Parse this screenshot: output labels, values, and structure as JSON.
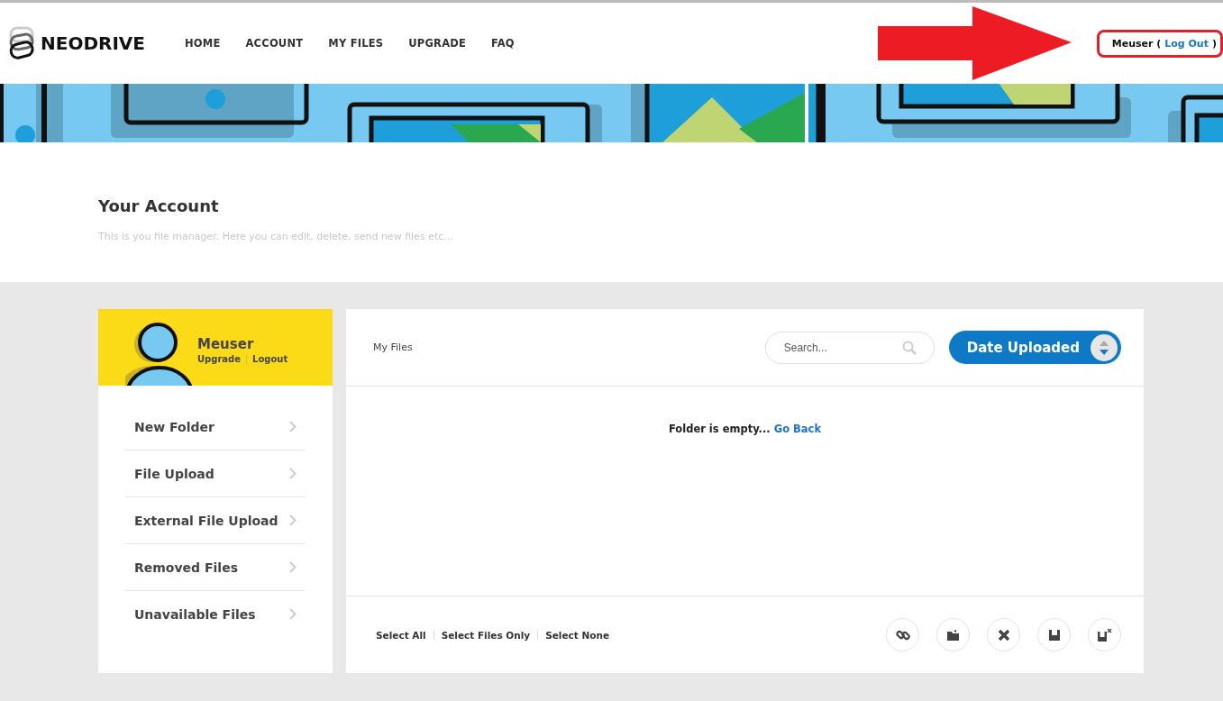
{
  "header": {
    "brand": "NEODRIVE",
    "nav": [
      {
        "label": "HOME"
      },
      {
        "label": "ACCOUNT"
      },
      {
        "label": "MY FILES"
      },
      {
        "label": "UPGRADE"
      },
      {
        "label": "FAQ"
      }
    ],
    "user": {
      "name": "Meuser",
      "open": "(",
      "link": "Log Out",
      "close": ")"
    }
  },
  "intro": {
    "title": "Your Account",
    "subtitle": "This is you file manager. Here you can edit, delete, send new files etc..."
  },
  "profile": {
    "name": "Meuser",
    "links": [
      "Upgrade",
      "Logout"
    ]
  },
  "menu": [
    {
      "label": "New Folder"
    },
    {
      "label": "File Upload"
    },
    {
      "label": "External File Upload"
    },
    {
      "label": "Removed Files"
    },
    {
      "label": "Unavailable Files"
    }
  ],
  "files": {
    "breadcrumb": "My Files",
    "search": {
      "placeholder": "Search..."
    },
    "sort": "Date Uploaded",
    "empty": "Folder is empty...",
    "back": "Go Back",
    "select": [
      "Select All",
      "Select Files Only",
      "Select None"
    ],
    "actions": [
      {
        "kind": "link"
      },
      {
        "kind": "move"
      },
      {
        "kind": "delete"
      },
      {
        "kind": "save"
      },
      {
        "kind": "unsave"
      }
    ]
  }
}
